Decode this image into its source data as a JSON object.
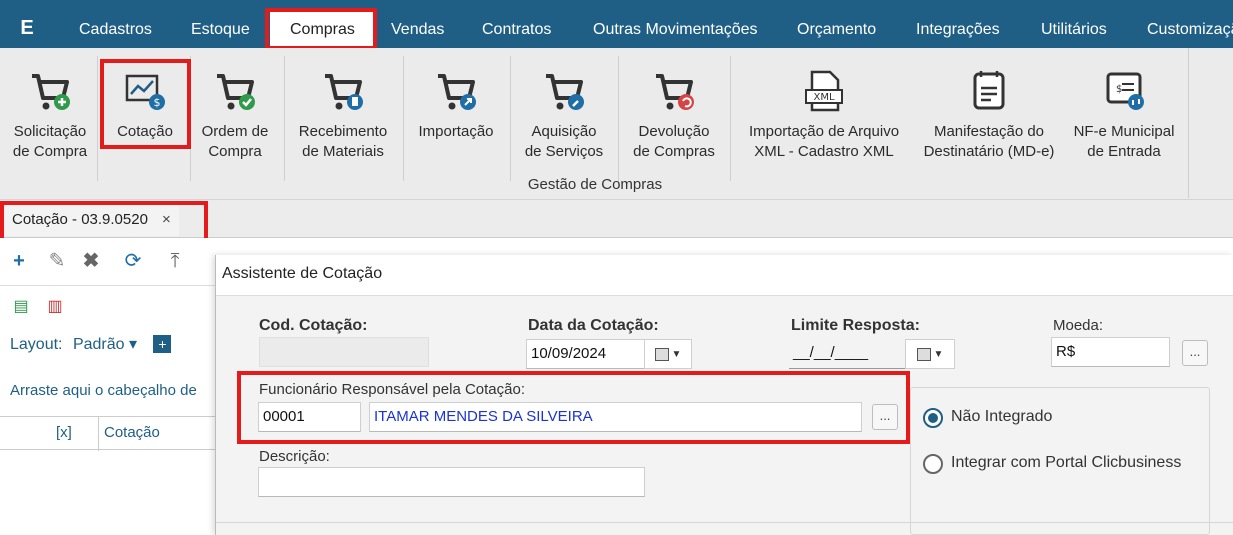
{
  "menubar": {
    "logo": "E",
    "items": [
      {
        "label": "Cadastros"
      },
      {
        "label": "Estoque"
      },
      {
        "label": "Compras"
      },
      {
        "label": "Vendas"
      },
      {
        "label": "Contratos"
      },
      {
        "label": "Outras Movimentações"
      },
      {
        "label": "Orçamento"
      },
      {
        "label": "Integrações"
      },
      {
        "label": "Utilitários"
      },
      {
        "label": "Customizaçã"
      }
    ],
    "active": "Compras"
  },
  "ribbon": {
    "group_label": "Gestão de Compras",
    "buttons": [
      {
        "label": "Solicitação\nde Compra",
        "icon": "cart-add-icon"
      },
      {
        "label": "Cotação",
        "icon": "chart-dollar-icon"
      },
      {
        "label": "Ordem de\nCompra",
        "icon": "cart-check-icon"
      },
      {
        "label": "Recebimento\nde Materiais",
        "icon": "cart-doc-icon"
      },
      {
        "label": "Importação",
        "icon": "cart-import-icon"
      },
      {
        "label": "Aquisição\nde Serviços",
        "icon": "cart-wrench-icon"
      },
      {
        "label": "Devolução\nde Compras",
        "icon": "cart-return-icon"
      },
      {
        "label": "Importação de Arquivo\nXML - Cadastro XML",
        "icon": "xml-file-icon"
      },
      {
        "label": "Manifestação do\nDestinatário (MD-e)",
        "icon": "calendar-doc-icon"
      },
      {
        "label": "NF-e Municipal\nde Entrada",
        "icon": "nfe-icon"
      }
    ]
  },
  "doc_tab": {
    "label": "Cotação - 03.9.0520",
    "close": "×"
  },
  "left_pane": {
    "layout_label": "Layout:",
    "layout_value": "Padrão ▾",
    "drag_hint": "Arraste aqui o cabeçalho de",
    "columns": [
      "[x]",
      "Cotação"
    ]
  },
  "dialog": {
    "title": "Assistente de Cotação",
    "cod_cotacao_label": "Cod. Cotação:",
    "cod_cotacao_value": "",
    "data_cotacao_label": "Data da Cotação:",
    "data_cotacao_value": "10/09/2024",
    "limite_resposta_label": "Limite Resposta:",
    "limite_resposta_value": "__/__/____",
    "moeda_label": "Moeda:",
    "moeda_value": "R$",
    "funcionario_label": "Funcionário Responsável pela Cotação:",
    "funcionario_code": "00001",
    "funcionario_name": "ITAMAR MENDES DA SILVEIRA",
    "descricao_label": "Descrição:",
    "descricao_value": "",
    "ellipsis": "...",
    "radio_options": [
      {
        "label": "Não Integrado",
        "checked": true
      },
      {
        "label": "Integrar com Portal Clicbusiness",
        "checked": false
      }
    ]
  },
  "colors": {
    "menubar": "#1f5f86",
    "highlight": "#e41b1b",
    "accent": "#1f5f86",
    "name_text": "#1a33d6"
  }
}
